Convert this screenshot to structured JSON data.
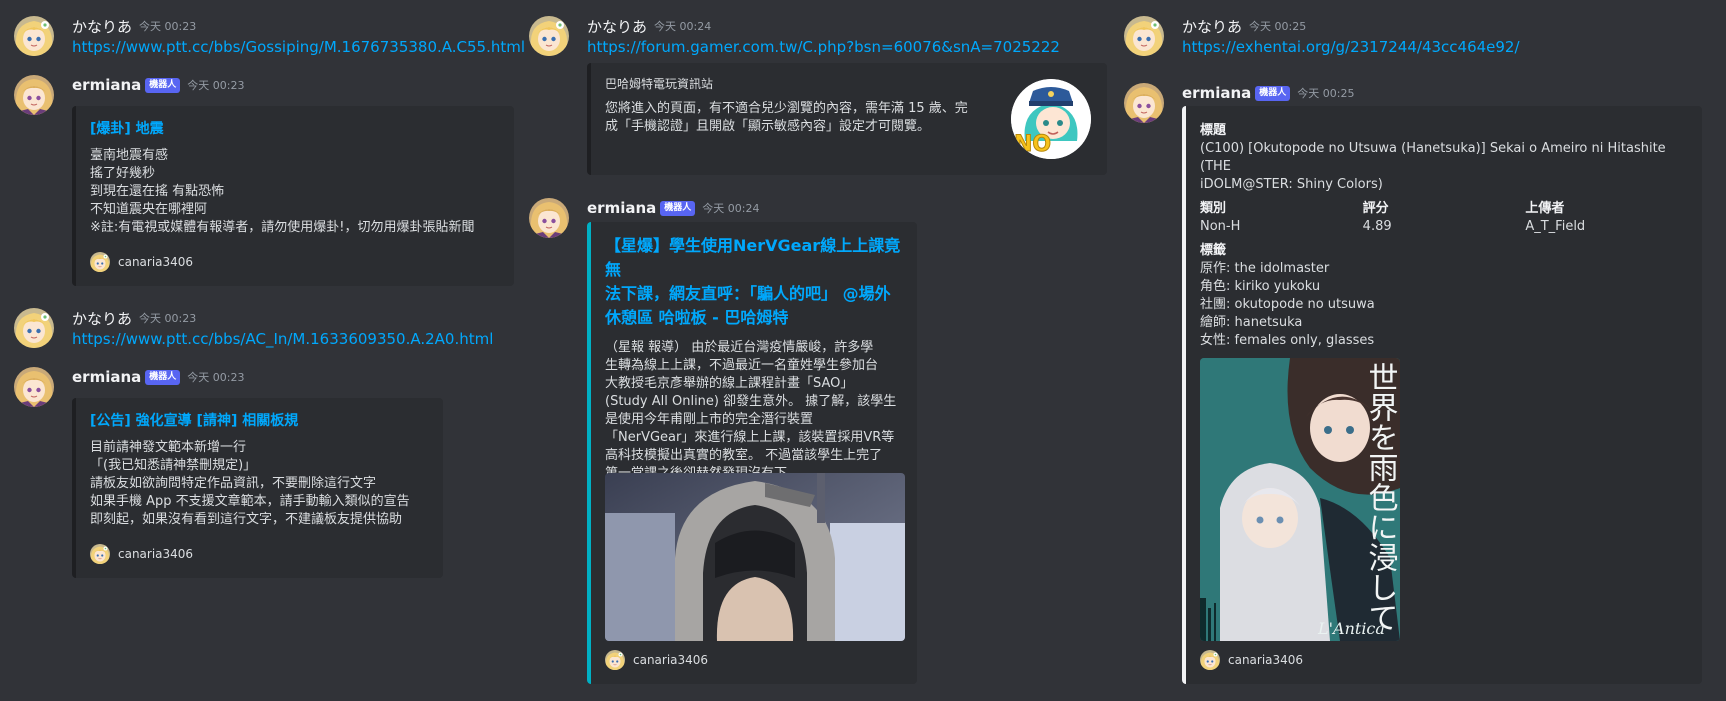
{
  "columns": [
    {
      "messages": [
        {
          "author": "かなりあ",
          "timestamp": "今天 00:23",
          "link": "https://www.ptt.cc/bbs/Gossiping/M.1676735380.A.C55.html"
        },
        {
          "author": "ermiana",
          "badge": "機器人",
          "timestamp": "今天 00:23",
          "embed": {
            "title": "[爆卦] 地震",
            "description": "臺南地震有感\n搖了好幾秒\n到現在還在搖 有點恐怖\n不知道震央在哪裡阿\n※註:有電視或媒體有報導者，請勿使用爆卦!，切勿用爆卦張貼新聞",
            "footer": "canaria3406"
          }
        },
        {
          "author": "かなりあ",
          "timestamp": "今天 00:23",
          "link": "https://www.ptt.cc/bbs/AC_In/M.1633609350.A.2A0.html"
        },
        {
          "author": "ermiana",
          "badge": "機器人",
          "timestamp": "今天 00:23",
          "embed": {
            "title": "[公告] 強化宣導 [請神] 相關板規",
            "description": "目前請神發文範本新增一行\n「(我已知悉請神禁刪規定)」\n請板友如欲詢問特定作品資訊，不要刪除這行文字\n如果手機 App 不支援文章範本，請手動輸入類似的宣告\n即刻起，如果沒有看到這行文字，不建議板友提供協助",
            "footer": "canaria3406"
          }
        }
      ]
    },
    {
      "messages": [
        {
          "author": "かなりあ",
          "timestamp": "今天 00:24",
          "link": "https://forum.gamer.com.tw/C.php?bsn=60076&snA=7025222",
          "embed": {
            "provider": "巴哈姆特電玩資訊站",
            "description": "您將進入的頁面，有不適合兒少瀏覽的內容，需年滿 15 歲、完\n成「手機認證」且開啟「顯示敏感內容」設定才可閱覽。",
            "thumbnail_label": "NO"
          }
        },
        {
          "author": "ermiana",
          "badge": "機器人",
          "timestamp": "今天 00:24",
          "embed": {
            "title": "【星爆】學生使用NerVGear線上上課竟無\n法下課，網友直呼：「騙人的吧」 @場外\n休憩區 哈啦板 - 巴哈姆特",
            "description": "（星報 報導） 由於最近台灣疫情嚴峻，許多學\n生轉為線上上課，不過最近一名童姓學生參加台\n大教授毛京彥舉辦的線上課程計畫「SAO」\n(Study All Online) 卻發生意外。 據了解，該學生\n是使用今年甫剛上市的完全潛行裝置\n「NerVGear」來進行線上上課，該裝置採用VR等\n高科技模擬出真實的教室。 不過當該學生上完了\n第一堂課之後卻赫然發現沒有下",
            "footer": "canaria3406"
          }
        }
      ]
    },
    {
      "messages": [
        {
          "author": "かなりあ",
          "timestamp": "今天 00:25",
          "link": "https://exhentai.org/g/2317244/43cc464e92/"
        },
        {
          "author": "ermiana",
          "badge": "機器人",
          "timestamp": "今天 00:25",
          "embed": {
            "fields": {
              "title_name": "標題",
              "title_value": "(C100) [Okutopode no Utsuwa (Hanetsuka)] Sekai o Ameiro ni Hitashite (THE\niDOLM@STER: Shiny Colors)",
              "category_name": "類別",
              "category_value": "Non-H",
              "rating_name": "評分",
              "rating_value": "4.89",
              "uploader_name": "上傳者",
              "uploader_value": "A_T_Field",
              "tags_name": "標籤",
              "tags_value": "原作: the idolmaster\n角色: kiriko yukoku\n社團: okutopode no utsuwa\n繪師: hanetsuka\n女性: females only, glasses"
            },
            "cover_title": "世界を雨色に浸して",
            "cover_signature": "L'Antica",
            "footer": "canaria3406"
          }
        }
      ]
    }
  ],
  "colors": {
    "background": "#313338",
    "embed": "#2b2d31",
    "link": "#00a8fc",
    "bot_badge": "#5865f2",
    "teal_bar": "#00b0c4"
  }
}
